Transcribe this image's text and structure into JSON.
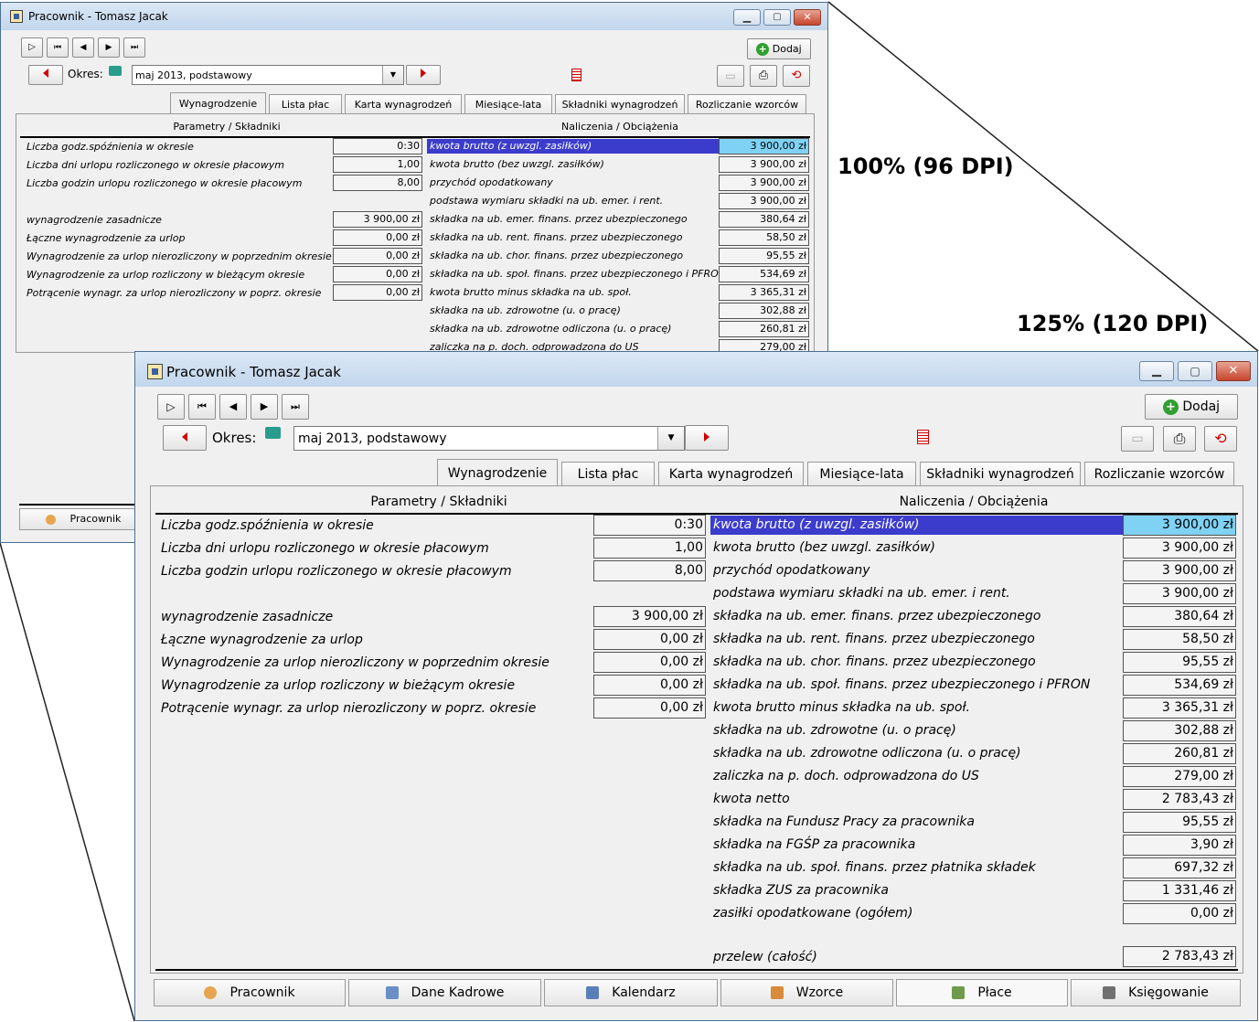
{
  "captions": {
    "dpi100": "100% (96 DPI)",
    "dpi125": "125% (120 DPI)"
  },
  "window": {
    "title": "Pracownik - Tomasz Jacak",
    "toolbar": {
      "add_label": "Dodaj",
      "period_label": "Okres:",
      "period_value": "maj 2013, podstawowy"
    },
    "tabs": [
      "Wynagrodzenie",
      "Lista płac",
      "Karta wynagrodzeń",
      "Miesiące-lata",
      "Składniki wynagrodzeń",
      "Rozliczanie wzorców"
    ],
    "headers": {
      "left": "Parametry / Składniki",
      "right": "Naliczenia / Obciążenia"
    },
    "left_rows": [
      {
        "label": "Liczba godz.spóźnienia w okresie",
        "value": "0:30"
      },
      {
        "label": "Liczba dni urlopu rozliczonego w okresie płacowym",
        "value": "1,00"
      },
      {
        "label": "Liczba godzin urlopu rozliczonego w okresie płacowym",
        "value": "8,00"
      },
      {
        "label": "wynagrodzenie zasadnicze",
        "value": "3 900,00 zł"
      },
      {
        "label": "Łączne wynagrodzenie za urlop",
        "value": "0,00 zł"
      },
      {
        "label": "Wynagrodzenie za urlop nierozliczony w poprzednim okresie",
        "value": "0,00 zł"
      },
      {
        "label": "Wynagrodzenie za urlop rozliczony w bieżącym okresie",
        "value": "0,00 zł"
      },
      {
        "label": "Potrącenie wynagr. za urlop nierozliczony w poprz. okresie",
        "value": "0,00 zł"
      }
    ],
    "right_rows": [
      {
        "label": "kwota brutto (z uwzgl. zasiłków)",
        "value": "3 900,00 zł"
      },
      {
        "label": "kwota brutto (bez uwzgl. zasiłków)",
        "value": "3 900,00 zł"
      },
      {
        "label": "przychód opodatkowany",
        "value": "3 900,00 zł"
      },
      {
        "label": "podstawa wymiaru składki na ub. emer. i rent.",
        "value": "3 900,00 zł"
      },
      {
        "label": "składka na ub. emer. finans. przez ubezpieczonego",
        "value": "380,64 zł"
      },
      {
        "label": "składka na ub. rent. finans. przez ubezpieczonego",
        "value": "58,50 zł"
      },
      {
        "label": "składka na ub. chor. finans. przez ubezpieczonego",
        "value": "95,55 zł"
      },
      {
        "label": "składka na ub. społ. finans. przez ubezpieczonego i PFRON",
        "value": "534,69 zł"
      },
      {
        "label": "kwota brutto minus składka na ub. społ.",
        "value": "3 365,31 zł"
      },
      {
        "label": "składka na ub. zdrowotne (u. o pracę)",
        "value": "302,88 zł"
      },
      {
        "label": "składka na ub. zdrowotne odliczona (u. o pracę)",
        "value": "260,81 zł"
      },
      {
        "label": "zaliczka na p. doch. odprowadzona do US",
        "value": "279,00 zł"
      },
      {
        "label": "kwota netto",
        "value": "2 783,43 zł"
      },
      {
        "label": "składka na Fundusz Pracy za pracownika",
        "value": "95,55 zł"
      },
      {
        "label": "składka na FGŚP za pracownika",
        "value": "3,90 zł"
      },
      {
        "label": "składka na ub. społ. finans. przez płatnika składek",
        "value": "697,32 zł"
      },
      {
        "label": "składka ZUS za pracownika",
        "value": "1 331,46 zł"
      },
      {
        "label": "zasiłki opodatkowane (ogółem)",
        "value": "0,00 zł"
      }
    ],
    "total_row": {
      "label": "przelew (całość)",
      "value": "2 783,43 zł"
    },
    "bottom_tabs": [
      "Pracownik",
      "Dane Kadrowe",
      "Kalendarz",
      "Wzorce",
      "Płace",
      "Księgowanie"
    ]
  },
  "colors": {
    "highlight_label": "#3c3ccc",
    "highlight_value": "#7fd2f4",
    "accent_red": "#d00000"
  }
}
